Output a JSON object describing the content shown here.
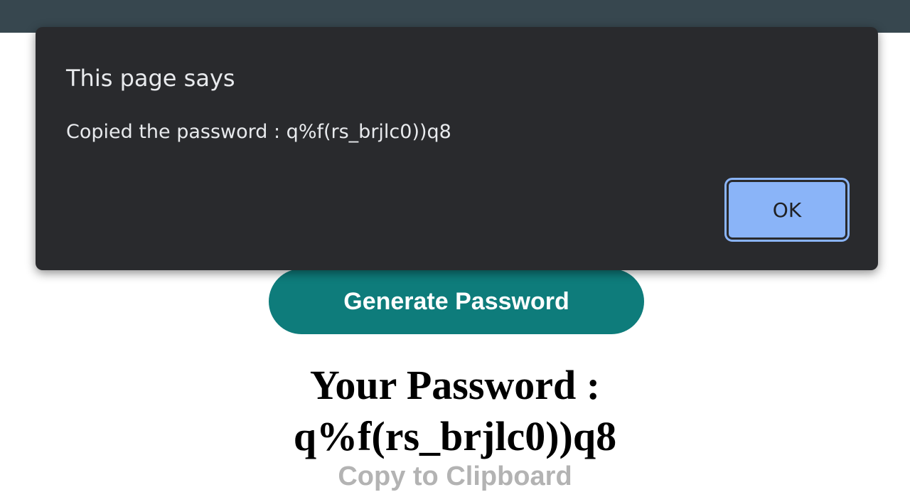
{
  "page": {
    "generate_button_label": "Generate Password",
    "result_heading": "Your Password :",
    "result_password": "q%f(rs_brjlc0))q8",
    "copy_label": "Copy to Clipboard"
  },
  "dialog": {
    "title": "This page says",
    "message": "Copied the password : q%f(rs_brjlc0))q8",
    "ok_label": "OK"
  },
  "colors": {
    "top_bar": "#37474f",
    "button_teal": "#0e7c7b",
    "dialog_bg": "#292a2d",
    "ok_blue": "#8ab4f8",
    "copy_gray": "#b3b3b3"
  }
}
